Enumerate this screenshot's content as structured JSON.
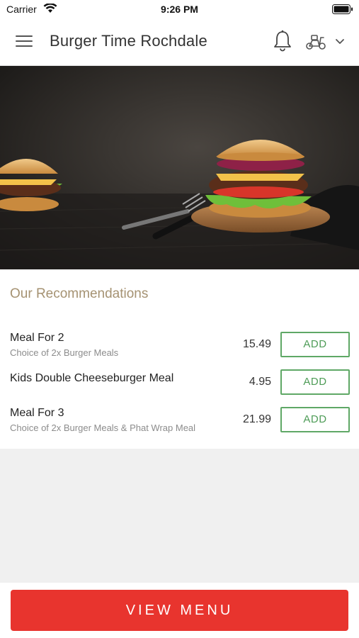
{
  "status_bar": {
    "carrier": "Carrier",
    "time": "9:26 PM"
  },
  "header": {
    "title": "Burger Time Rochdale",
    "icons": [
      "menu-icon",
      "bell-icon",
      "scooter-icon",
      "chevron-down-icon"
    ]
  },
  "hero": {
    "image": "burger-photo"
  },
  "recommendations": {
    "title": "Our Recommendations",
    "items": [
      {
        "name": "Meal For 2",
        "description": "Choice of 2x Burger Meals",
        "price": "15.49",
        "button": "ADD"
      },
      {
        "name": "Kids Double Cheeseburger Meal",
        "description": "",
        "price": "4.95",
        "button": "ADD"
      },
      {
        "name": "Meal For 3",
        "description": "Choice of 2x Burger Meals & Phat Wrap Meal",
        "price": "21.99",
        "button": "ADD"
      }
    ]
  },
  "footer": {
    "view_menu_label": "VIEW MENU"
  },
  "colors": {
    "accent_red": "#e8342e",
    "add_green": "#5fa866",
    "heading_gold": "#a59272"
  }
}
